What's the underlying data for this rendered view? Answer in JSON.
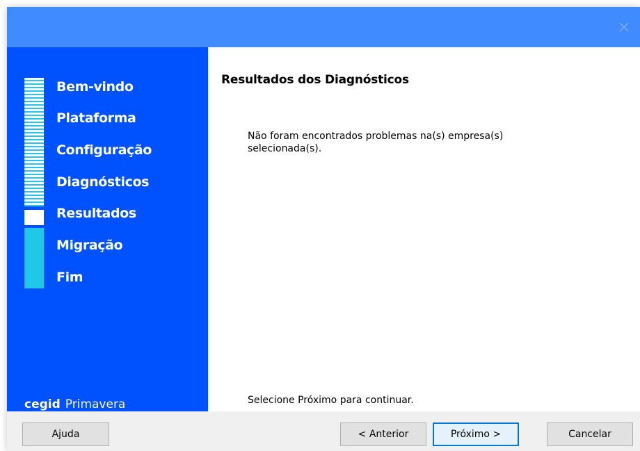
{
  "window": {
    "close_icon": "close-icon",
    "colors": {
      "titlebar": "#3f8bff",
      "sidebar": "#0051ff",
      "progress_done": "#ffffff",
      "progress_todo": "#21c7e8",
      "default_button_border": "#0078d7"
    }
  },
  "sidebar": {
    "steps": [
      {
        "label": "Bem-vindo",
        "state": "done"
      },
      {
        "label": "Plataforma",
        "state": "done"
      },
      {
        "label": "Configuração",
        "state": "done"
      },
      {
        "label": "Diagnósticos",
        "state": "done"
      },
      {
        "label": "Resultados",
        "state": "current"
      },
      {
        "label": "Migração",
        "state": "pending"
      },
      {
        "label": "Fim",
        "state": "pending"
      }
    ],
    "brand": {
      "strong": "cegid",
      "light": "Primavera"
    }
  },
  "content": {
    "title": "Resultados dos Diagnósticos",
    "message": "Não foram encontrados problemas na(s) empresa(s) selecionada(s).",
    "hint": "Selecione Próximo para continuar."
  },
  "footer": {
    "help_label": "Ajuda",
    "back_label": "< Anterior",
    "next_label": "Próximo >",
    "cancel_label": "Cancelar"
  }
}
